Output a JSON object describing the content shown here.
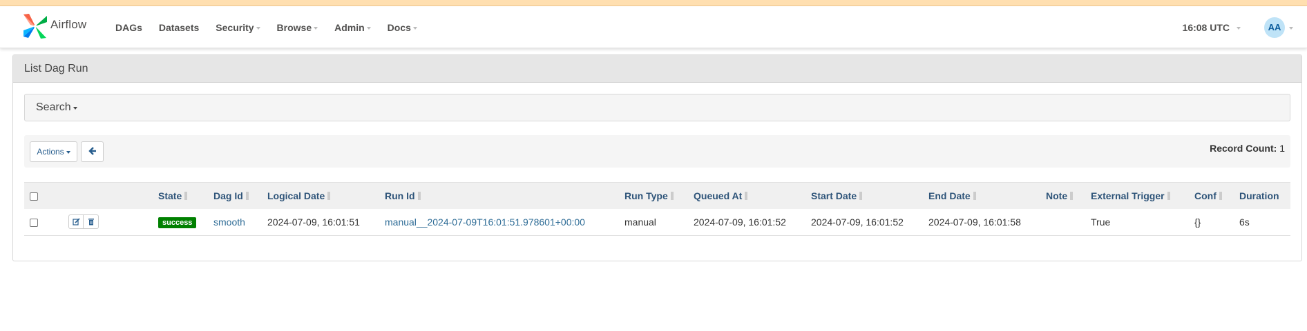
{
  "app": {
    "brand": "Airflow",
    "menu": [
      {
        "label": "DAGs",
        "dropdown": false
      },
      {
        "label": "Datasets",
        "dropdown": false
      },
      {
        "label": "Security",
        "dropdown": true
      },
      {
        "label": "Browse",
        "dropdown": true
      },
      {
        "label": "Admin",
        "dropdown": true
      },
      {
        "label": "Docs",
        "dropdown": true
      }
    ],
    "clock": "16:08 UTC",
    "user_initials": "AA"
  },
  "panel": {
    "title": "List Dag Run",
    "search_label": "Search",
    "actions_label": "Actions",
    "record_count_label": "Record Count:",
    "record_count": "1"
  },
  "table": {
    "columns": [
      "State",
      "Dag Id",
      "Logical Date",
      "Run Id",
      "Run Type",
      "Queued At",
      "Start Date",
      "End Date",
      "Note",
      "External Trigger",
      "Conf",
      "Duration"
    ],
    "rows": [
      {
        "state": "success",
        "dag_id": "smooth",
        "logical_date": "2024-07-09, 16:01:51",
        "run_id": "manual__2024-07-09T16:01:51.978601+00:00",
        "run_type": "manual",
        "queued_at": "2024-07-09, 16:01:52",
        "start_date": "2024-07-09, 16:01:52",
        "end_date": "2024-07-09, 16:01:58",
        "note": "",
        "external_trigger": "True",
        "conf": "{}",
        "duration": "6s"
      }
    ]
  },
  "colors": {
    "top_strip": "#ffdfb0",
    "link": "#2e6c96",
    "header_text": "#2e5479",
    "success": "#008000",
    "avatar_bg": "#bfe3f7"
  },
  "icons": [
    "airflow-logo-icon",
    "edit-icon",
    "trash-icon",
    "arrow-left-icon",
    "caret-down-icon",
    "sort-icon"
  ]
}
